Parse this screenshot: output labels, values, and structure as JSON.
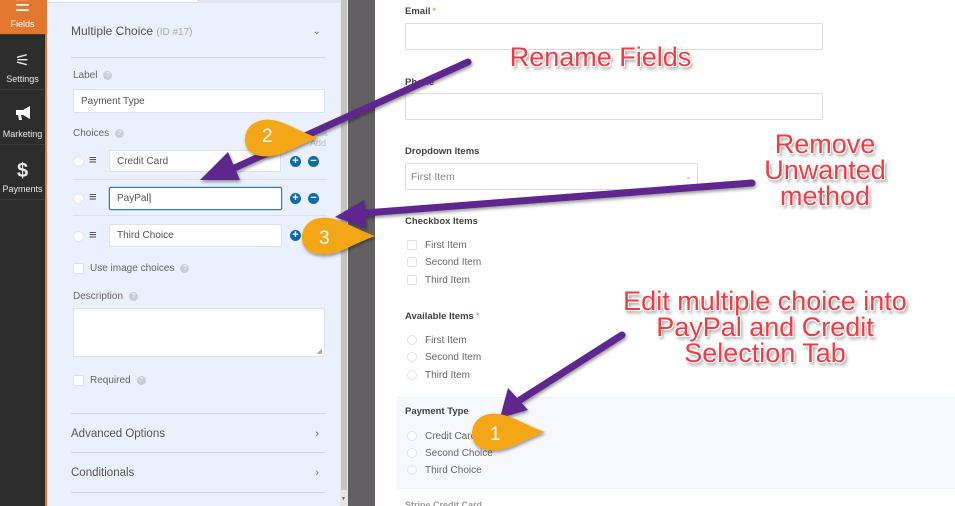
{
  "nav": {
    "items": [
      {
        "label": "Fields",
        "icon": "list-icon",
        "glyph": "☰",
        "active": true
      },
      {
        "label": "Settings",
        "icon": "sliders-icon",
        "glyph": "☷",
        "active": false
      },
      {
        "label": "Marketing",
        "icon": "megaphone-icon",
        "glyph": "📢",
        "active": false
      },
      {
        "label": "Payments",
        "icon": "dollar-icon",
        "glyph": "$",
        "active": false
      }
    ],
    "accent": "#e27730"
  },
  "panel": {
    "title": "Multiple Choice",
    "field_id": "(ID #17)",
    "label_label": "Label",
    "label_value": "Payment Type",
    "choices_label": "Choices",
    "bulk_add": "Bulk Add",
    "choices": [
      {
        "value": "Credit Card",
        "can_remove": true,
        "focused": false
      },
      {
        "value": "PayPal",
        "can_remove": true,
        "focused": true
      },
      {
        "value": "Third Choice",
        "can_remove": false,
        "focused": false
      }
    ],
    "use_image_choices": "Use image choices",
    "description_label": "Description",
    "description_value": "",
    "required_label": "Required",
    "advanced_options": "Advanced Options",
    "conditionals": "Conditionals"
  },
  "preview": {
    "email_label": "Email",
    "phone_label": "Phone",
    "required_mark": "*",
    "dropdown_label": "Dropdown Items",
    "dropdown_value": "First Item",
    "checkbox_label": "Checkbox Items",
    "checkbox_items": [
      "First Item",
      "Second Item",
      "Third Item"
    ],
    "available_label": "Available Items",
    "available_items": [
      "First Item",
      "Second Item",
      "Third Item"
    ],
    "payment_label": "Payment Type",
    "payment_items": [
      "Credit Card",
      "Second Choice",
      "Third Choice"
    ],
    "next_field_label": "Stripe Credit Card"
  },
  "annotations": {
    "rename": "Rename Fields",
    "remove": [
      "Remove",
      "Unwanted",
      "method"
    ],
    "edit": [
      "Edit multiple choice into",
      "PayPal and Credit",
      "Selection Tab"
    ],
    "badges": [
      "1",
      "2",
      "3"
    ],
    "arrow_color": "#5f2590",
    "badge_color": "#f3a712",
    "text_color": "#ef3b42"
  }
}
